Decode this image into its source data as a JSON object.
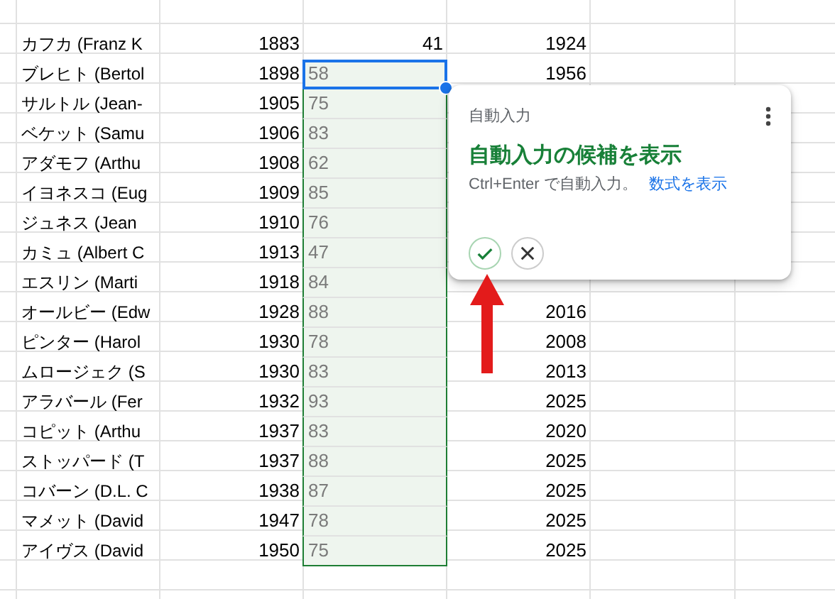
{
  "rows": [
    {
      "name": "カフカ (Franz K",
      "born": "1883",
      "value": "41",
      "kind": "entered",
      "died": "1924"
    },
    {
      "name": "ブレヒト (Bertol",
      "born": "1898",
      "value": "58",
      "kind": "suggestion",
      "active": true,
      "died": "1956"
    },
    {
      "name": "サルトル (Jean-",
      "born": "1905",
      "value": "75",
      "kind": "suggestion",
      "active": false
    },
    {
      "name": "ベケット (Samu",
      "born": "1906",
      "value": "83",
      "kind": "suggestion",
      "active": false
    },
    {
      "name": "アダモフ (Arthu",
      "born": "1908",
      "value": "62",
      "kind": "suggestion",
      "active": false
    },
    {
      "name": "イヨネスコ (Eug",
      "born": "1909",
      "value": "85",
      "kind": "suggestion",
      "active": false
    },
    {
      "name": "ジュネス (Jean",
      "born": "1910",
      "value": "76",
      "kind": "suggestion",
      "active": false
    },
    {
      "name": "カミュ (Albert C",
      "born": "1913",
      "value": "47",
      "kind": "suggestion",
      "active": false
    },
    {
      "name": "エスリン (Marti",
      "born": "1918",
      "value": "84",
      "kind": "suggestion",
      "active": false
    },
    {
      "name": "オールビー (Edw",
      "born": "1928",
      "value": "88",
      "kind": "suggestion",
      "active": false,
      "died": "2016"
    },
    {
      "name": "ピンター (Harol",
      "born": "1930",
      "value": "78",
      "kind": "suggestion",
      "active": false,
      "died": "2008"
    },
    {
      "name": "ムロージェク (S",
      "born": "1930",
      "value": "83",
      "kind": "suggestion",
      "active": false,
      "died": "2013"
    },
    {
      "name": "アラバール (Fer",
      "born": "1932",
      "value": "93",
      "kind": "suggestion",
      "active": false,
      "died": "2025"
    },
    {
      "name": "コピット (Arthu",
      "born": "1937",
      "value": "83",
      "kind": "suggestion",
      "active": false,
      "died": "2020"
    },
    {
      "name": "ストッパード (T",
      "born": "1937",
      "value": "88",
      "kind": "suggestion",
      "active": false,
      "died": "2025"
    },
    {
      "name": "コバーン (D.L. C",
      "born": "1938",
      "value": "87",
      "kind": "suggestion",
      "active": false,
      "died": "2025"
    },
    {
      "name": "マメット (David",
      "born": "1947",
      "value": "78",
      "kind": "suggestion",
      "active": false,
      "died": "2025"
    },
    {
      "name": "アイヴス (David",
      "born": "1950",
      "value": "75",
      "kind": "suggestion",
      "active": false,
      "died": "2025"
    }
  ],
  "autofill_popup": {
    "header": "自動入力",
    "title": "自動入力の候補を表示",
    "hint": "Ctrl+Enter で自動入力。",
    "link": "数式を表示"
  }
}
